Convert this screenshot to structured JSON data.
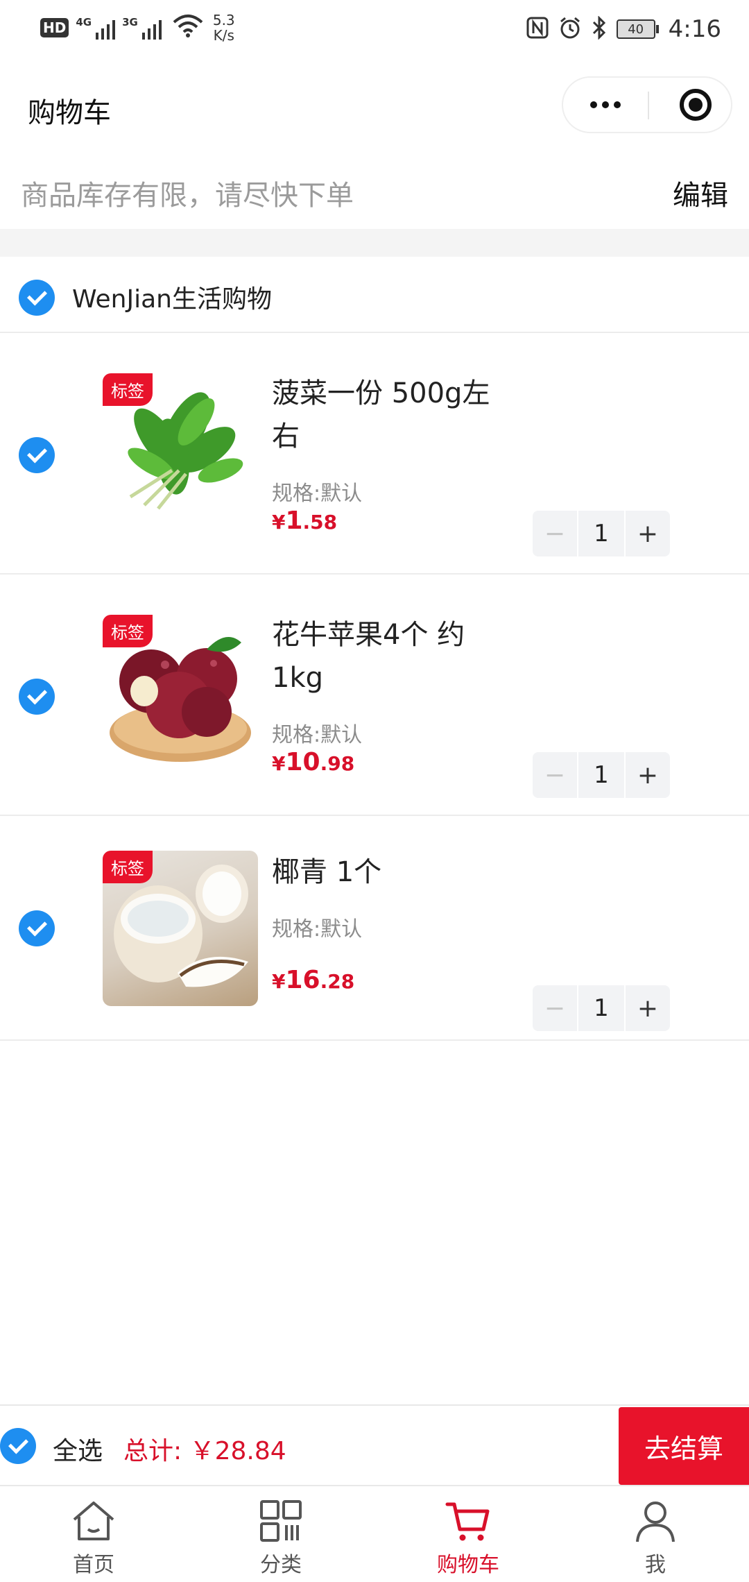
{
  "status_bar": {
    "hd": "HD",
    "net1": "4G",
    "net2": "3G",
    "speed_value": "5.3",
    "speed_unit": "K/s",
    "battery": "40",
    "time": "4:16"
  },
  "header": {
    "title": "购物车"
  },
  "notice": {
    "text": "商品库存有限，请尽快下单",
    "edit_label": "编辑"
  },
  "shop": {
    "name": "WenJian生活购物",
    "checked": true
  },
  "items": [
    {
      "tag": "标签",
      "name": "菠菜一份 500g左右",
      "spec": "规格:默认",
      "price_symbol": "¥",
      "price_int": "1",
      "price_dec": ".58",
      "qty": "1",
      "minus": "−",
      "plus": "+",
      "image": "spinach",
      "checked": true
    },
    {
      "tag": "标签",
      "name": "花牛苹果4个 约1kg",
      "spec": "规格:默认",
      "price_symbol": "¥",
      "price_int": "10",
      "price_dec": ".98",
      "qty": "1",
      "minus": "−",
      "plus": "+",
      "image": "apple",
      "checked": true
    },
    {
      "tag": "标签",
      "name": "椰青 1个",
      "spec": "规格:默认",
      "price_symbol": "¥",
      "price_int": "16",
      "price_dec": ".28",
      "qty": "1",
      "minus": "−",
      "plus": "+",
      "image": "coconut",
      "checked": true
    }
  ],
  "summary": {
    "select_all_label": "全选",
    "total_label": "总计:",
    "total_value": "￥28.84",
    "checkout_label": "去结算"
  },
  "tabs": [
    {
      "label": "首页",
      "icon": "home-icon",
      "active": false
    },
    {
      "label": "分类",
      "icon": "category-grid-icon",
      "active": false
    },
    {
      "label": "购物车",
      "icon": "cart-icon",
      "active": true
    },
    {
      "label": "我",
      "icon": "user-icon",
      "active": false
    }
  ],
  "colors": {
    "accent_red": "#e8132b",
    "price_red": "#d8102a",
    "check_blue": "#1e8ef0"
  }
}
